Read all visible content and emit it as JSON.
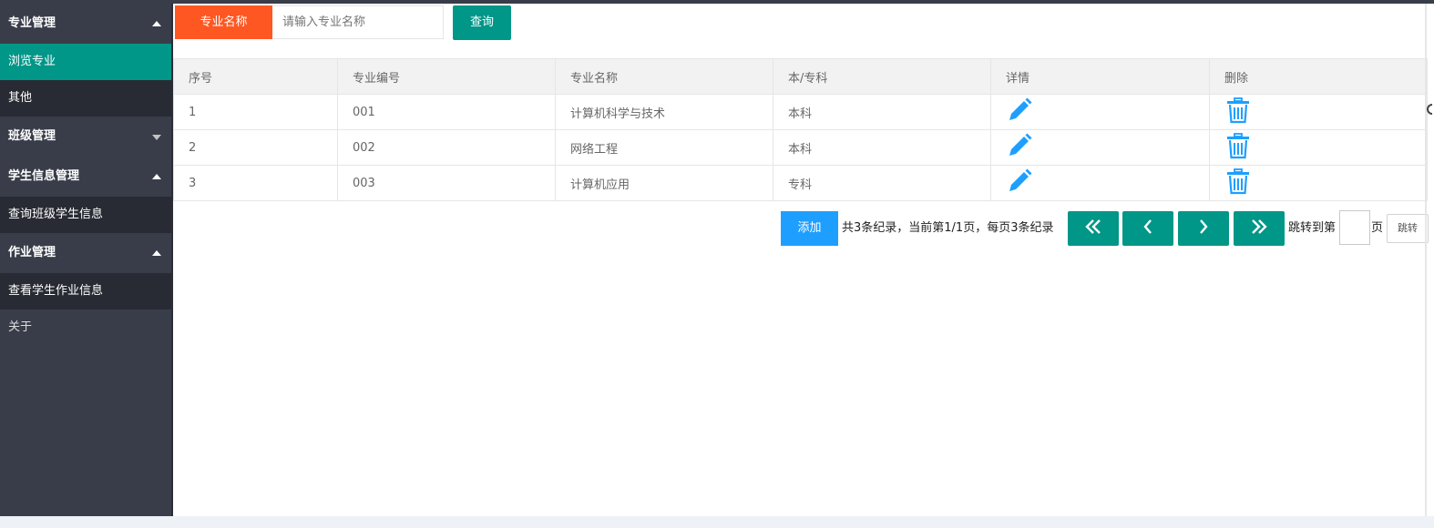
{
  "sidebar": {
    "groups": [
      {
        "label": "专业管理",
        "expanded": true,
        "children": [
          {
            "label": "浏览专业",
            "active": true
          },
          {
            "label": "其他",
            "active": false
          }
        ]
      },
      {
        "label": "班级管理",
        "expanded": false,
        "children": []
      },
      {
        "label": "学生信息管理",
        "expanded": true,
        "children": [
          {
            "label": "查询班级学生信息",
            "active": false
          }
        ]
      },
      {
        "label": "作业管理",
        "expanded": true,
        "children": [
          {
            "label": "查看学生作业信息",
            "active": false
          }
        ]
      }
    ],
    "extra_item": "关于"
  },
  "search": {
    "label": "专业名称",
    "placeholder": "请输入专业名称",
    "value": "",
    "button": "查询"
  },
  "table": {
    "columns": [
      "序号",
      "专业编号",
      "专业名称",
      "本/专科",
      "详情",
      "删除"
    ],
    "rows": [
      {
        "index": "1",
        "code": "001",
        "name": "计算机科学与技术",
        "level": "本科"
      },
      {
        "index": "2",
        "code": "002",
        "name": "网络工程",
        "level": "本科"
      },
      {
        "index": "3",
        "code": "003",
        "name": "计算机应用",
        "level": "专科"
      }
    ],
    "detail_icon": "pencil-icon",
    "delete_icon": "trash-icon"
  },
  "pager": {
    "add_button": "添加",
    "info": "共3条纪录，当前第1/1页，每页3条纪录",
    "jump_prefix": "跳转到第",
    "jump_suffix": "页",
    "jump_value": "",
    "jump_button": "跳转",
    "icons": [
      "double-left-icon",
      "left-icon",
      "right-icon",
      "double-right-icon"
    ]
  },
  "colors": {
    "sidebar_bg": "#393d49",
    "sidebar_child_bg": "#282b33",
    "active": "#009688",
    "search_label": "#ff5722",
    "add_button": "#1e9fff",
    "icon_blue": "#1e9fff"
  }
}
